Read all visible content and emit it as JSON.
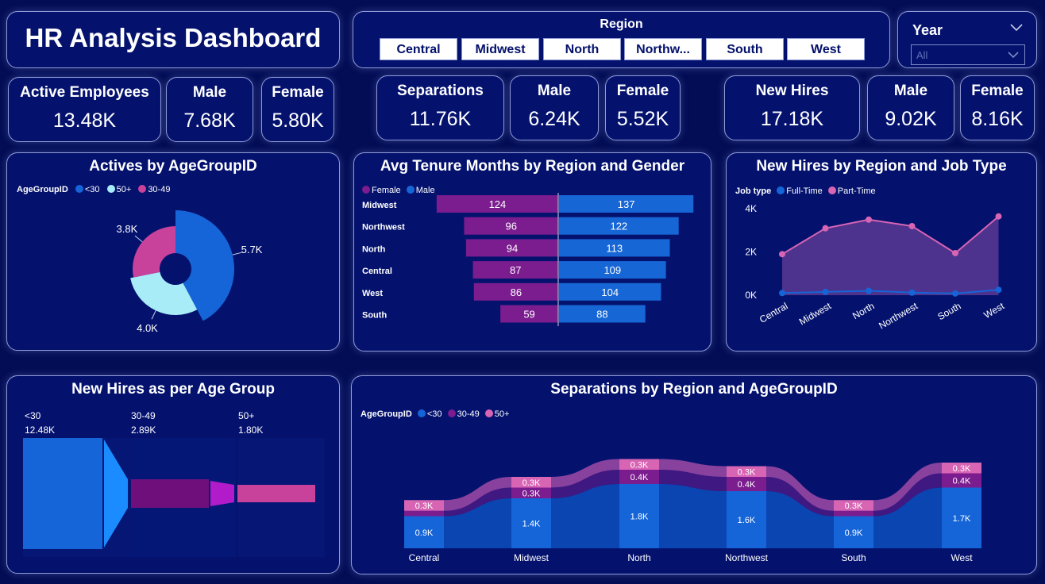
{
  "title": "HR Analysis Dashboard",
  "region_slicer": {
    "label": "Region",
    "options": [
      "Central",
      "Midwest",
      "North",
      "Northw...",
      "South",
      "West"
    ]
  },
  "year_slicer": {
    "label": "Year",
    "placeholder": "All"
  },
  "kpis": {
    "active": [
      {
        "label": "Active Employees",
        "value": "13.48K"
      },
      {
        "label": "Male",
        "value": "7.68K"
      },
      {
        "label": "Female",
        "value": "5.80K"
      }
    ],
    "separations": [
      {
        "label": "Separations",
        "value": "11.76K"
      },
      {
        "label": "Male",
        "value": "6.24K"
      },
      {
        "label": "Female",
        "value": "5.52K"
      }
    ],
    "new_hires": [
      {
        "label": "New Hires",
        "value": "17.18K"
      },
      {
        "label": "Male",
        "value": "9.02K"
      },
      {
        "label": "Female",
        "value": "8.16K"
      }
    ]
  },
  "colors": {
    "under30": "#1565d8",
    "over50": "#a8ecf8",
    "age30_49": "#c8419a",
    "female": "#7b1c8f",
    "male": "#1766d6",
    "fulltime": "#1565d8",
    "parttime": "#d864b4"
  },
  "actives_chart": {
    "title": "Actives by AgeGroupID",
    "legend_title": "AgeGroupID",
    "legend": [
      "<30",
      "50+",
      "30-49"
    ]
  },
  "tenure_chart": {
    "title": "Avg Tenure Months by Region and Gender",
    "legend": [
      "Female",
      "Male"
    ]
  },
  "hires_jobtype_chart": {
    "title": "New Hires by Region and Job Type",
    "legend_title": "Job type",
    "legend": [
      "Full-Time",
      "Part-Time"
    ],
    "y_ticks": [
      "4K",
      "2K",
      "0K"
    ]
  },
  "funnel_chart": {
    "title": "New Hires as per Age Group",
    "groups": [
      {
        "label": "<30",
        "value": "12.48K"
      },
      {
        "label": "30-49",
        "value": "2.89K"
      },
      {
        "label": "50+",
        "value": "1.80K"
      }
    ]
  },
  "separations_chart": {
    "title": "Separations by Region and AgeGroupID",
    "legend_title": "AgeGroupID",
    "legend": [
      "<30",
      "30-49",
      "50+"
    ]
  },
  "chart_data": [
    {
      "type": "pie",
      "title": "Actives by AgeGroupID",
      "categories": [
        "<30",
        "50+",
        "30-49"
      ],
      "values": [
        5.7,
        4.0,
        3.8
      ],
      "value_labels": [
        "5.7K",
        "4.0K",
        "3.8K"
      ]
    },
    {
      "type": "bar",
      "title": "Avg Tenure Months by Region and Gender",
      "categories": [
        "Midwest",
        "Northwest",
        "North",
        "Central",
        "West",
        "South"
      ],
      "series": [
        {
          "name": "Female",
          "values": [
            124,
            96,
            94,
            87,
            86,
            59
          ]
        },
        {
          "name": "Male",
          "values": [
            137,
            122,
            113,
            109,
            104,
            88
          ]
        }
      ]
    },
    {
      "type": "area",
      "title": "New Hires by Region and Job Type",
      "categories": [
        "Central",
        "Midwest",
        "North",
        "Northwest",
        "South",
        "West"
      ],
      "series": [
        {
          "name": "Full-Time",
          "values": [
            0.1,
            0.15,
            0.2,
            0.12,
            0.08,
            0.25
          ]
        },
        {
          "name": "Part-Time",
          "values": [
            1.9,
            3.1,
            3.5,
            3.2,
            1.95,
            3.65
          ]
        }
      ],
      "ylim": [
        0,
        4
      ]
    },
    {
      "type": "bar",
      "title": "New Hires as per Age Group",
      "categories": [
        "<30",
        "30-49",
        "50+"
      ],
      "values": [
        12.48,
        2.89,
        1.8
      ]
    },
    {
      "type": "bar",
      "title": "Separations by Region and AgeGroupID",
      "categories": [
        "Central",
        "Midwest",
        "North",
        "Northwest",
        "South",
        "West"
      ],
      "series": [
        {
          "name": "<30",
          "values": [
            0.9,
            1.4,
            1.8,
            1.6,
            0.9,
            1.7
          ],
          "labels": [
            "0.9K",
            "1.4K",
            "1.8K",
            "1.6K",
            "0.9K",
            "1.7K"
          ]
        },
        {
          "name": "30-49",
          "values": [
            0.15,
            0.3,
            0.4,
            0.4,
            0.15,
            0.4
          ],
          "labels": [
            "",
            "0.3K",
            "0.4K",
            "0.4K",
            "",
            "0.4K"
          ]
        },
        {
          "name": "50+",
          "values": [
            0.3,
            0.3,
            0.3,
            0.3,
            0.3,
            0.3
          ],
          "labels": [
            "0.3K",
            "0.3K",
            "0.3K",
            "0.3K",
            "0.3K",
            "0.3K"
          ]
        }
      ]
    }
  ]
}
